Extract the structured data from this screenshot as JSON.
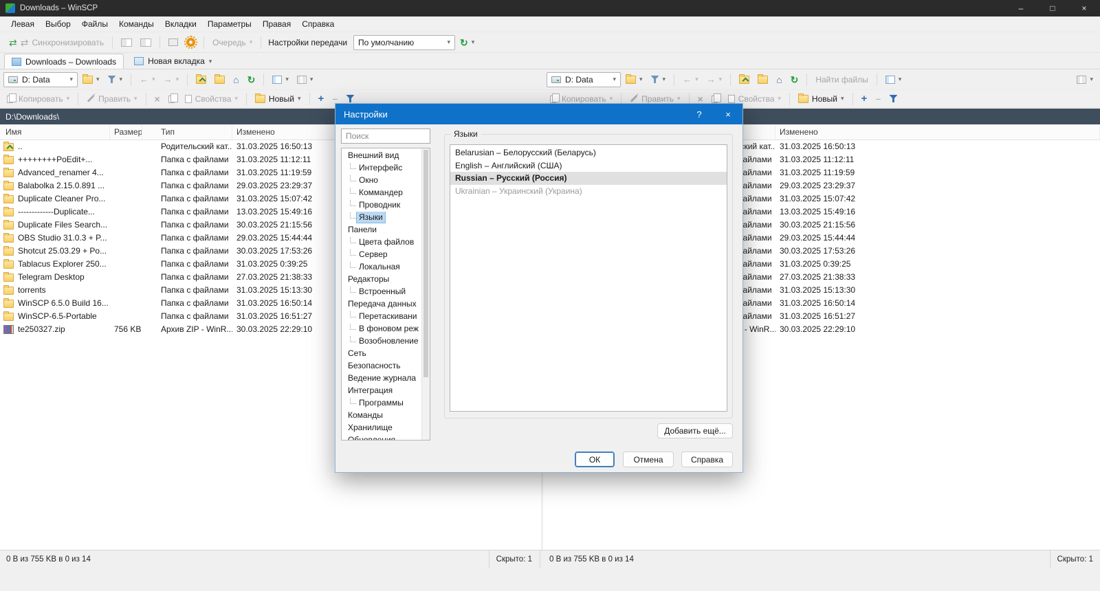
{
  "window": {
    "title": "Downloads – WinSCP",
    "controls": {
      "minimize": "–",
      "maximize": "□",
      "close": "×"
    }
  },
  "menu": {
    "items": [
      "Левая",
      "Выбор",
      "Файлы",
      "Команды",
      "Вкладки",
      "Параметры",
      "Правая",
      "Справка"
    ]
  },
  "main_toolbar": {
    "synchronize": "Синхронизировать",
    "queue": "Очередь",
    "transfer_settings": "Настройки передачи",
    "transfer_preset": "По умолчанию"
  },
  "tab_bar": {
    "active_tab": "Downloads – Downloads",
    "new_tab": "Новая вкладка"
  },
  "panel_toolbar": {
    "drive": "D: Data",
    "copy": "Копировать",
    "edit": "Править",
    "properties": "Свойства",
    "new": "Новый",
    "find_files": "Найти файлы"
  },
  "path": "D:\\Downloads\\",
  "columns": [
    "Имя",
    "Размер",
    "Тип",
    "Изменено"
  ],
  "files": [
    {
      "name": "..",
      "size": "",
      "type": "Родительский кат...",
      "modified": "31.03.2025 16:50:13",
      "icon": "parent"
    },
    {
      "name": "++++++++PoEdit+...",
      "size": "",
      "type": "Папка с файлами",
      "modified": "31.03.2025 11:12:11",
      "icon": "folder"
    },
    {
      "name": "Advanced_renamer 4...",
      "size": "",
      "type": "Папка с файлами",
      "modified": "31.03.2025 11:19:59",
      "icon": "folder"
    },
    {
      "name": "Balabolka 2.15.0.891 ...",
      "size": "",
      "type": "Папка с файлами",
      "modified": "29.03.2025 23:29:37",
      "icon": "folder"
    },
    {
      "name": "Duplicate Cleaner Pro...",
      "size": "",
      "type": "Папка с файлами",
      "modified": "31.03.2025 15:07:42",
      "icon": "folder"
    },
    {
      "name": "-------------Duplicate...",
      "size": "",
      "type": "Папка с файлами",
      "modified": "13.03.2025 15:49:16",
      "icon": "folder"
    },
    {
      "name": "Duplicate Files Search...",
      "size": "",
      "type": "Папка с файлами",
      "modified": "30.03.2025 21:15:56",
      "icon": "folder"
    },
    {
      "name": "OBS Studio 31.0.3 + P...",
      "size": "",
      "type": "Папка с файлами",
      "modified": "29.03.2025 15:44:44",
      "icon": "folder"
    },
    {
      "name": "Shotcut 25.03.29 + Po...",
      "size": "",
      "type": "Папка с файлами",
      "modified": "30.03.2025 17:53:26",
      "icon": "folder"
    },
    {
      "name": "Tablacus Explorer 250...",
      "size": "",
      "type": "Папка с файлами",
      "modified": "31.03.2025 0:39:25",
      "icon": "folder"
    },
    {
      "name": "Telegram Desktop",
      "size": "",
      "type": "Папка с файлами",
      "modified": "27.03.2025 21:38:33",
      "icon": "folder"
    },
    {
      "name": "torrents",
      "size": "",
      "type": "Папка с файлами",
      "modified": "31.03.2025 15:13:30",
      "icon": "folder"
    },
    {
      "name": "WinSCP 6.5.0 Build 16...",
      "size": "",
      "type": "Папка с файлами",
      "modified": "31.03.2025 16:50:14",
      "icon": "folder"
    },
    {
      "name": "WinSCP-6.5-Portable",
      "size": "",
      "type": "Папка с файлами",
      "modified": "31.03.2025 16:51:27",
      "icon": "folder"
    },
    {
      "name": "te250327.zip",
      "size": "756 KB",
      "type": "Архив ZIP - WinR...",
      "modified": "30.03.2025 22:29:10",
      "icon": "zip"
    }
  ],
  "statusbar": {
    "summary": "0 B из 755 KB в 0 из 14",
    "hidden": "Скрыто: 1"
  },
  "dialog": {
    "title": "Настройки",
    "help_button": "?",
    "close_button": "×",
    "search_placeholder": "Поиск",
    "tree": [
      {
        "label": "Внешний вид",
        "level": 0
      },
      {
        "label": "Интерфейс",
        "level": 1
      },
      {
        "label": "Окно",
        "level": 1
      },
      {
        "label": "Коммандер",
        "level": 1
      },
      {
        "label": "Проводник",
        "level": 1
      },
      {
        "label": "Языки",
        "level": 1,
        "selected": true
      },
      {
        "label": "Панели",
        "level": 0
      },
      {
        "label": "Цвета файлов",
        "level": 1
      },
      {
        "label": "Сервер",
        "level": 1
      },
      {
        "label": "Локальная",
        "level": 1
      },
      {
        "label": "Редакторы",
        "level": 0
      },
      {
        "label": "Встроенный",
        "level": 1
      },
      {
        "label": "Передача данных",
        "level": 0
      },
      {
        "label": "Перетаскивани",
        "level": 1
      },
      {
        "label": "В фоновом реж",
        "level": 1
      },
      {
        "label": "Возобновление",
        "level": 1
      },
      {
        "label": "Сеть",
        "level": 0
      },
      {
        "label": "Безопасность",
        "level": 0
      },
      {
        "label": "Ведение журнала",
        "level": 0
      },
      {
        "label": "Интеграция",
        "level": 0
      },
      {
        "label": "Программы",
        "level": 1
      },
      {
        "label": "Команды",
        "level": 0
      },
      {
        "label": "Хранилище",
        "level": 0
      },
      {
        "label": "Обновления",
        "level": 0
      }
    ],
    "group_title": "Языки",
    "languages": [
      {
        "label": "Belarusian – Белорусский (Беларусь)",
        "state": "normal"
      },
      {
        "label": "English – Английский (США)",
        "state": "normal"
      },
      {
        "label": "Russian – Русский (Россия)",
        "state": "selected"
      },
      {
        "label": "Ukrainian – Украинский (Украина)",
        "state": "disabled"
      }
    ],
    "add_more": "Добавить ещё...",
    "ok": "ОК",
    "cancel": "Отмена",
    "help": "Справка"
  },
  "colors": {
    "dialog_titlebar": "#0f72c8",
    "path_bar": "#3f4e5d",
    "tree_selection": "#bcd9f3",
    "list_selection": "#e0e0e0",
    "folder_icon": "#f7cf62"
  }
}
